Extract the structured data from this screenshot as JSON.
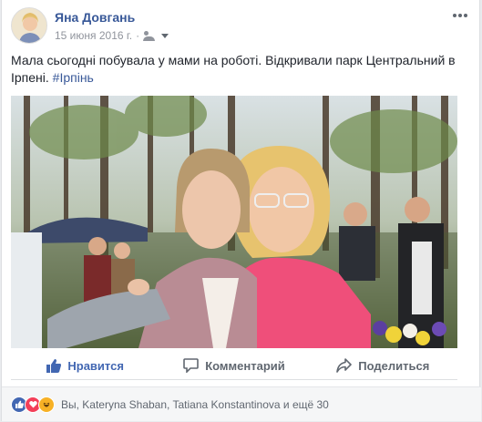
{
  "post": {
    "author": "Яна Довгань",
    "date": "15 июня 2016 г.",
    "separator": "·",
    "text": "Мала сьогодні побувала у мами на роботі. Відкривали парк Центральний в Ірпені.",
    "hashtag": "#Ірпінь"
  },
  "actions": {
    "like": "Нравится",
    "comment": "Комментарий",
    "share": "Поделиться"
  },
  "reactions": {
    "summary": "Вы, Kateryna Shaban, Tatiana Konstantinova и ещё 30",
    "icons": [
      "like-icon",
      "love-icon",
      "haha-icon"
    ]
  },
  "colors": {
    "brand_blue": "#4267b2",
    "link_blue": "#385898",
    "love_red": "#f33e58",
    "haha_yellow": "#f7b125"
  }
}
